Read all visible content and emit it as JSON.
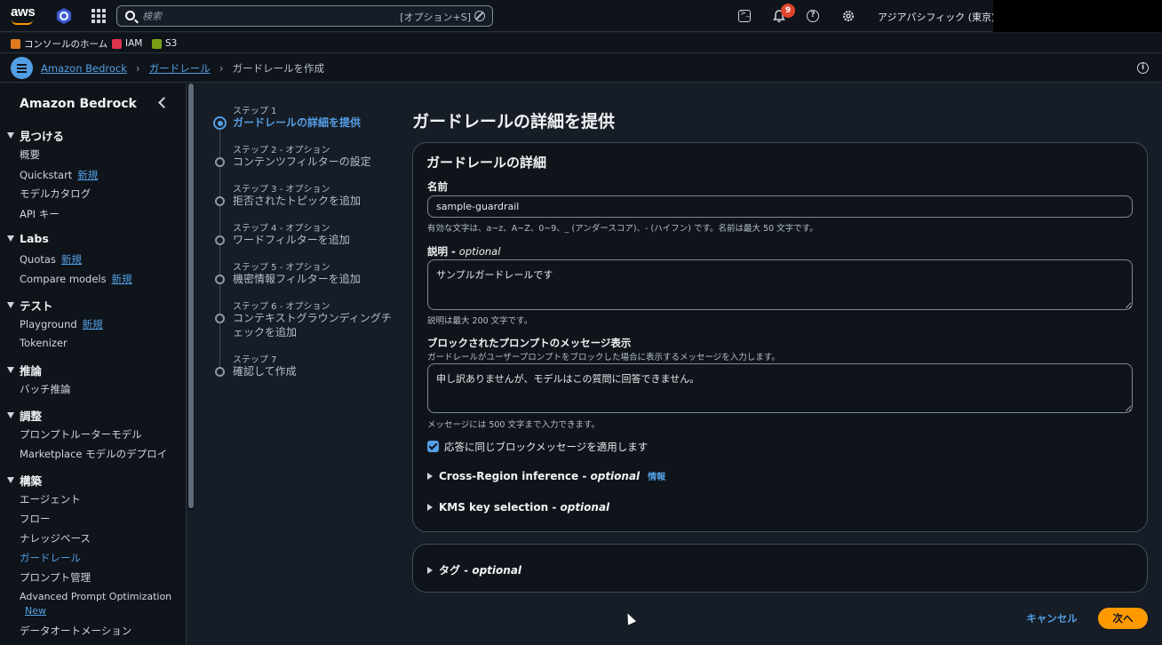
{
  "topnav": {
    "logo_text": "aws",
    "search_placeholder": "検索",
    "search_shortcut": "[オプション+S]",
    "notifications_count": "9",
    "region": "アジアパシフィック (東京)"
  },
  "favorites": [
    {
      "label": "コンソールのホーム",
      "color": "#e07b1f"
    },
    {
      "label": "IAM",
      "color": "#dd344c"
    },
    {
      "label": "S3",
      "color": "#7aa116"
    }
  ],
  "breadcrumb": {
    "items": [
      "Amazon Bedrock",
      "ガードレール"
    ],
    "current": "ガードレールを作成"
  },
  "sidebar": {
    "title": "Amazon Bedrock",
    "new_label": "新規",
    "new_label_en": "New",
    "sections": [
      {
        "label": "見つける",
        "items": [
          {
            "label": "概要"
          },
          {
            "label": "Quickstart",
            "badge": "新規"
          },
          {
            "label": "モデルカタログ"
          },
          {
            "label": "API キー"
          }
        ]
      },
      {
        "label": "Labs",
        "items": [
          {
            "label": "Quotas",
            "badge": "新規"
          },
          {
            "label": "Compare models",
            "badge": "新規"
          }
        ]
      },
      {
        "label": "テスト",
        "items": [
          {
            "label": "Playground",
            "badge": "新規"
          },
          {
            "label": "Tokenizer"
          }
        ]
      },
      {
        "label": "推論",
        "items": [
          {
            "label": "バッチ推論"
          }
        ]
      },
      {
        "label": "調整",
        "items": [
          {
            "label": "プロンプトルーターモデル"
          },
          {
            "label": "Marketplace モデルのデプロイ"
          }
        ]
      },
      {
        "label": "構築",
        "items": [
          {
            "label": "エージェント"
          },
          {
            "label": "フロー"
          },
          {
            "label": "ナレッジベース"
          },
          {
            "label": "ガードレール",
            "active": true
          },
          {
            "label": "プロンプト管理"
          },
          {
            "label": "Advanced Prompt Optimization",
            "badge": "New"
          },
          {
            "label": "データオートメーション"
          }
        ]
      }
    ]
  },
  "steps": [
    {
      "label": "ステップ 1",
      "title": "ガードレールの詳細を提供",
      "active": true
    },
    {
      "label": "ステップ 2 - オプション",
      "title": "コンテンツフィルターの設定"
    },
    {
      "label": "ステップ 3 - オプション",
      "title": "拒否されたトピックを追加"
    },
    {
      "label": "ステップ 4 - オプション",
      "title": "ワードフィルターを追加"
    },
    {
      "label": "ステップ 5 - オプション",
      "title": "機密情報フィルターを追加"
    },
    {
      "label": "ステップ 6 - オプション",
      "title": "コンテキストグラウンディングチェックを追加"
    },
    {
      "label": "ステップ 7",
      "title": "確認して作成"
    }
  ],
  "main": {
    "page_title": "ガードレールの詳細を提供",
    "card_title": "ガードレールの詳細",
    "name_label": "名前",
    "name_value": "sample-guardrail",
    "name_hint": "有効な文字は、a~z、A~Z、0~9、_ (アンダースコア)、- (ハイフン) です。名前は最大 50 文字です。",
    "desc_label": "説明",
    "desc_optional": "optional",
    "desc_value": "サンプルガードレールです",
    "desc_hint": "説明は最大 200 文字です。",
    "blocked_label": "ブロックされたプロンプトのメッセージ表示",
    "blocked_desc": "ガードレールがユーザープロンプトをブロックした場合に表示するメッセージを入力します。",
    "blocked_value": "申し訳ありませんが、モデルはこの質問に回答できません。",
    "blocked_hint": "メッセージには 500 文字まで入力できます。",
    "checkbox_label": "応答に同じブロックメッセージを適用します",
    "checkbox_checked": true,
    "cross_region_label": "Cross-Region inference - ",
    "cross_region_optional": "optional",
    "info_link": "情報",
    "kms_label": "KMS key selection - ",
    "kms_optional": "optional",
    "tags_label": "タグ - ",
    "tags_optional": "optional"
  },
  "footer": {
    "cancel": "キャンセル",
    "next": "次へ"
  }
}
